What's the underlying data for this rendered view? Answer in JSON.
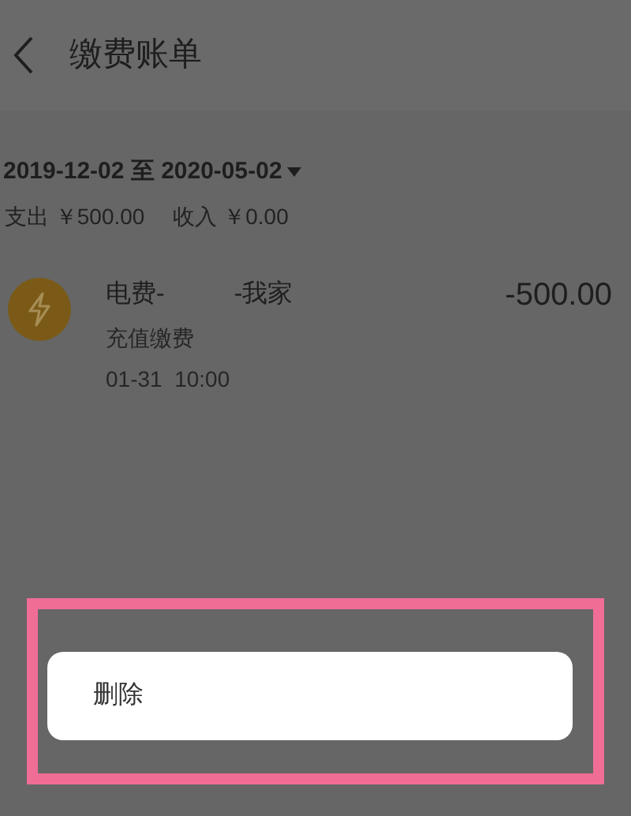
{
  "header": {
    "title": "缴费账单"
  },
  "date_range": {
    "start": "2019-12-02",
    "separator": "至",
    "end": "2020-05-02"
  },
  "summary": {
    "expense_label": "支出",
    "expense": "￥500.00",
    "income_label": "收入",
    "income": "￥0.00"
  },
  "records": [
    {
      "name_prefix": "电费-",
      "name_suffix": "-我家",
      "amount": "-500.00",
      "type": "充值缴费",
      "time": "01-31  10:00",
      "color": "#7a5a16"
    }
  ],
  "action_sheet": {
    "items": [
      "删除"
    ],
    "highlighted": true
  }
}
